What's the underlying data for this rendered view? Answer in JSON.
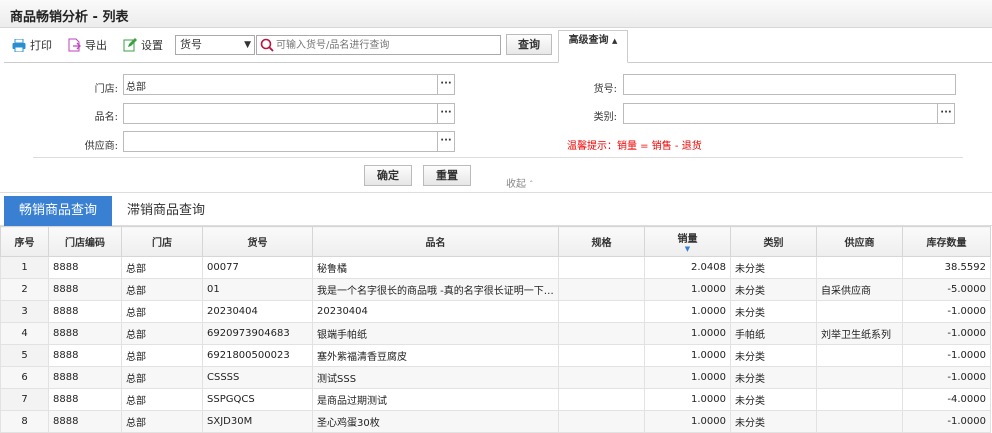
{
  "title": "商品畅销分析 - 列表",
  "toolbar": {
    "print": "打印",
    "export": "导出",
    "settings": "设置",
    "field_select": "货号",
    "search_placeholder": "可输入货号/品名进行查询",
    "query": "查询",
    "advanced": "高级查询"
  },
  "filters": {
    "store_label": "门店:",
    "store_value": "总部",
    "name_label": "品名:",
    "supplier_label": "供应商:",
    "code_label": "货号:",
    "category_label": "类别:",
    "tip": "温馨提示：销量 = 销售 - 退货",
    "confirm": "确定",
    "reset": "重置",
    "collapse": "收起"
  },
  "tabs": [
    "畅销商品查询",
    "滞销商品查询"
  ],
  "table": {
    "headers": [
      "序号",
      "门店编码",
      "门店",
      "货号",
      "品名",
      "规格",
      "销量",
      "类别",
      "供应商",
      "库存数量"
    ],
    "rows": [
      [
        "1",
        "8888",
        "总部",
        "00077",
        "秘鲁橘",
        "",
        "2.0408",
        "未分类",
        "",
        "38.5592"
      ],
      [
        "2",
        "8888",
        "总部",
        "01",
        "我是一个名字很长的商品哦 -真的名字很长证明一下名...",
        "",
        "1.0000",
        "未分类",
        "自采供应商",
        "-5.0000"
      ],
      [
        "3",
        "8888",
        "总部",
        "20230404",
        "20230404",
        "",
        "1.0000",
        "未分类",
        "",
        "-1.0000"
      ],
      [
        "4",
        "8888",
        "总部",
        "6920973904683",
        "银端手帕纸",
        "",
        "1.0000",
        "手帕纸",
        "刘举卫生纸系列",
        "-1.0000"
      ],
      [
        "5",
        "8888",
        "总部",
        "6921800500023",
        "塞外紫福清香豆腐皮",
        "",
        "1.0000",
        "未分类",
        "",
        "-1.0000"
      ],
      [
        "6",
        "8888",
        "总部",
        "CSSSS",
        "测试SSS",
        "",
        "1.0000",
        "未分类",
        "",
        "-1.0000"
      ],
      [
        "7",
        "8888",
        "总部",
        "SSPGQCS",
        "是商品过期测试",
        "",
        "1.0000",
        "未分类",
        "",
        "-4.0000"
      ],
      [
        "8",
        "8888",
        "总部",
        "SXJD30M",
        "圣心鸡蛋30枚",
        "",
        "1.0000",
        "未分类",
        "",
        "-1.0000"
      ]
    ]
  },
  "colors": {
    "accent": "#3a80d2",
    "tip": "#ee0000"
  }
}
